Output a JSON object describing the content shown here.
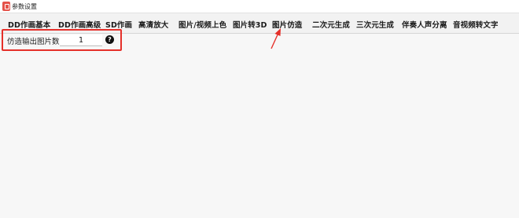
{
  "window": {
    "title": "参数设置",
    "icon": "app-icon"
  },
  "tabs": [
    {
      "label": "DD作画基本"
    },
    {
      "label": "DD作画高级"
    },
    {
      "label": "SD作画"
    },
    {
      "label": "高清放大"
    },
    {
      "label": "图片/视频上色"
    },
    {
      "label": "图片转3D"
    },
    {
      "label": "图片仿造",
      "active": true
    },
    {
      "label": "二次元生成"
    },
    {
      "label": "三次元生成"
    },
    {
      "label": "伴奏人声分离"
    },
    {
      "label": "音视频转文字"
    }
  ],
  "main": {
    "output_count": {
      "label": "仿造输出图片数",
      "value": "1",
      "help_glyph": "?"
    }
  },
  "annotation": {
    "highlight_color": "#e5302a",
    "arrow_color": "#e5302a"
  }
}
